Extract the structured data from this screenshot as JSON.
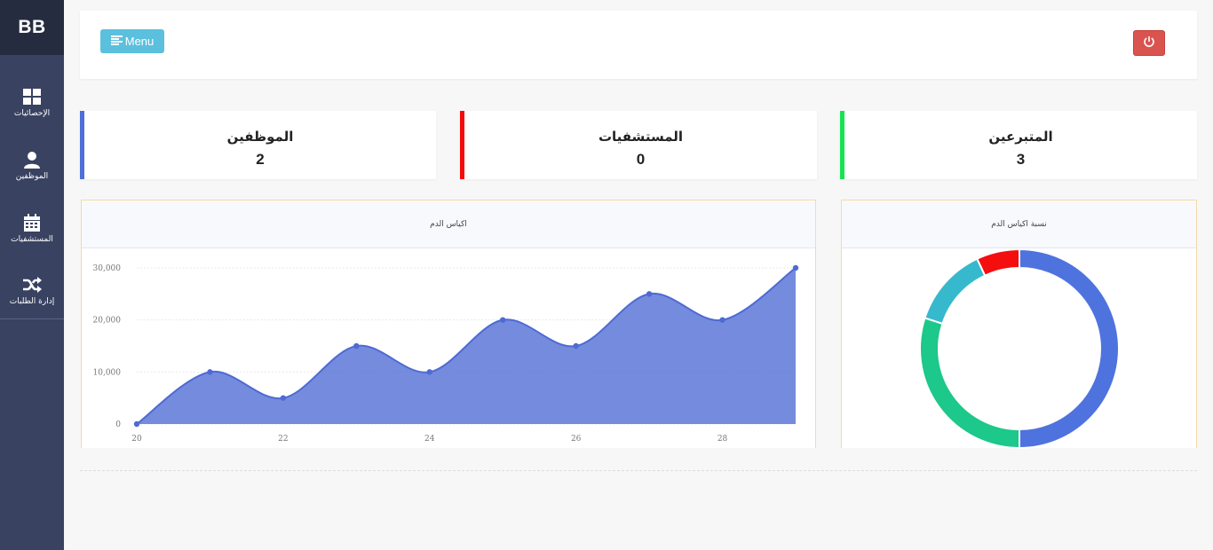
{
  "brand": "BB",
  "sidebar": {
    "items": [
      {
        "icon": "grid-icon",
        "label": "الإحصائيات"
      },
      {
        "icon": "user-icon",
        "label": "الموظفين"
      },
      {
        "icon": "calendar-icon",
        "label": "المستشفيات"
      },
      {
        "icon": "shuffle-icon",
        "label": "إدارة الطلبات"
      }
    ]
  },
  "header": {
    "menu_label": "Menu",
    "power_icon": "power-icon"
  },
  "stats": [
    {
      "title": "الموظفين",
      "value": "2",
      "color": "#4c6fd8"
    },
    {
      "title": "المستشفيات",
      "value": "0",
      "color": "#f20b0b"
    },
    {
      "title": "المتبرعين",
      "value": "3",
      "color": "#17e352"
    }
  ],
  "area_chart": {
    "title": "اكياس الدم",
    "chart_data": {
      "type": "area",
      "x": [
        20,
        21,
        22,
        23,
        24,
        25,
        26,
        27,
        28,
        29
      ],
      "values": [
        0,
        10000,
        5000,
        15000,
        10000,
        20000,
        15000,
        25000,
        20000,
        30000
      ],
      "xticks": [
        "20",
        "22",
        "24",
        "26",
        "28"
      ],
      "yticks": [
        "0",
        "10,000",
        "20,000",
        "30,000"
      ],
      "ylim": [
        0,
        30000
      ],
      "color": "#4e6ad4"
    }
  },
  "donut_chart": {
    "title": "نسبة اكياس الدم",
    "chart_data": {
      "type": "pie",
      "values": [
        50,
        30,
        13,
        7
      ],
      "colors": [
        "#4e73df",
        "#1cc88a",
        "#36b9cc",
        "#f50e0e"
      ]
    }
  }
}
